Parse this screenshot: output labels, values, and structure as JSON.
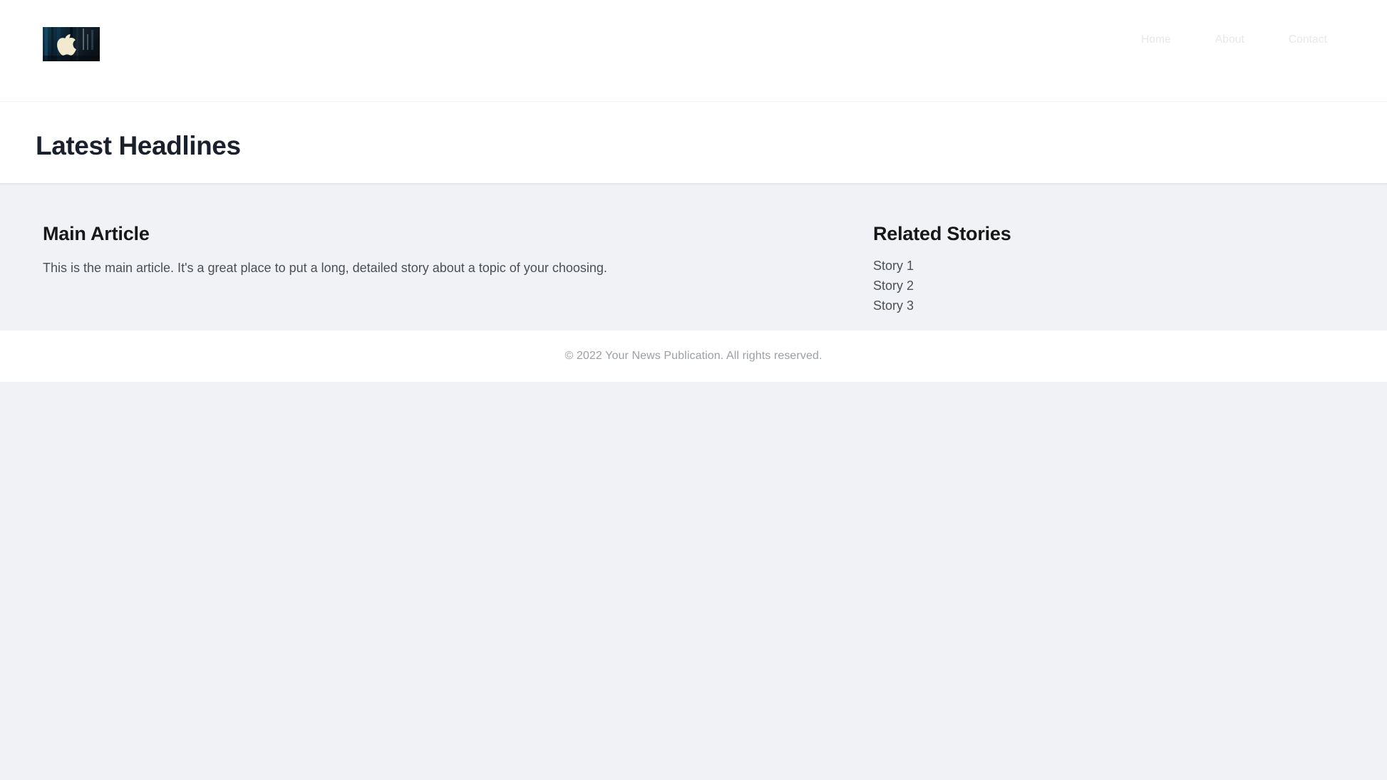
{
  "header": {
    "logo": {
      "alt": "Your News Publication logo",
      "icon": "apple-logo-photo",
      "background_color": "#0d2330",
      "glyph_color": "#f2e9cf"
    },
    "nav": [
      {
        "label": "Home",
        "name": "nav-link-home"
      },
      {
        "label": "About",
        "name": "nav-link-about"
      },
      {
        "label": "Contact",
        "name": "nav-link-contact"
      }
    ],
    "nav_color": "#e7e8ea"
  },
  "headline_band": {
    "title": "Latest Headlines",
    "title_color": "#1a202c"
  },
  "main": {
    "article": {
      "title": "Main Article",
      "body": "This is the main article. It's a great place to put a long, detailed story about a topic of your choosing."
    },
    "sidebar": {
      "title": "Related Stories",
      "stories": [
        {
          "label": "Story 1"
        },
        {
          "label": "Story 2"
        },
        {
          "label": "Story 3"
        }
      ]
    }
  },
  "footer": {
    "copyright": "© 2022 Your News Publication. All rights reserved.",
    "text_color": "#9aa0a6"
  },
  "theme": {
    "page_background": "#f1f2f6",
    "surface": "#ffffff",
    "heading": "#181818",
    "body_text": "#4a5056"
  }
}
